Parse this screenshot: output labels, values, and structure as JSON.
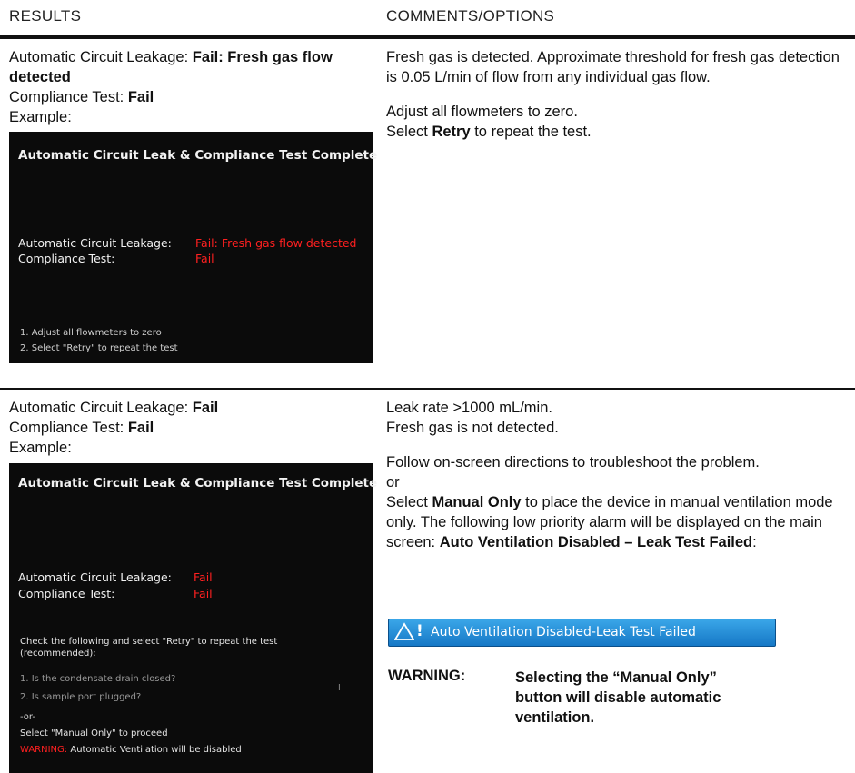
{
  "header": {
    "results": "RESULTS",
    "comments": "COMMENTS/OPTIONS"
  },
  "row1": {
    "left": {
      "leak_label": "Automatic Circuit Leakage: ",
      "leak_value": "Fail: Fresh gas flow detected",
      "comp_label": "Compliance Test: ",
      "comp_value": "Fail",
      "example": "Example:"
    },
    "screen": {
      "title": "Automatic Circuit Leak & Compliance Test Complete",
      "leak_label": "Automatic Circuit Leakage:",
      "leak_value": "Fail: Fresh gas flow detected",
      "comp_label": "Compliance Test:",
      "comp_value": "Fail",
      "step1": "1.   Adjust all flowmeters to zero",
      "step2": "2.   Select \"Retry\" to repeat the test"
    },
    "right": {
      "p1": "Fresh gas is detected. Approximate threshold for fresh gas detection is 0.05 L/min of flow from any individual gas flow.",
      "p2": "Adjust all flowmeters to zero.",
      "p3_pre": "Select ",
      "p3_bold": "Retry",
      "p3_post": " to repeat the test."
    }
  },
  "row2": {
    "left": {
      "leak_label": "Automatic Circuit Leakage: ",
      "leak_value": "Fail",
      "comp_label": "Compliance Test: ",
      "comp_value": "Fail",
      "example": "Example:"
    },
    "screen": {
      "title": "Automatic Circuit Leak & Compliance Test Complete",
      "leak_label": "Automatic Circuit Leakage:",
      "leak_value": "Fail",
      "comp_label": "Compliance Test:",
      "comp_value": "Fail",
      "check": "Check the following and select \"Retry\" to repeat the test (recommended):",
      "item1": "1.   Is the condensate drain closed?",
      "item2": "2.   Is sample port plugged?",
      "or": "-or-",
      "manual": "Select \"Manual Only\" to proceed",
      "warn_word": "WARNING:",
      "warn_text": " Automatic Ventilation will be disabled"
    },
    "right": {
      "p1": "Leak rate >1000 mL/min.",
      "p2": "Fresh gas is not detected.",
      "p3": "Follow on-screen directions to troubleshoot the problem.",
      "p4": "or",
      "p5_pre": "Select ",
      "p5_bold": "Manual Only",
      "p5_post": " to place the device in manual ventilation mode only. The following low priority alarm will be displayed on the main screen: ",
      "p5_bold2": "Auto Ventilation Disabled – Leak Test Failed",
      "p5_end": ":"
    },
    "alarm": {
      "excl": "!",
      "text": "Auto Ventilation Disabled-Leak Test Failed"
    },
    "warning": {
      "label": "WARNING:",
      "text": "Selecting the “Manual Only” button will disable automatic ventilation."
    },
    "cursor_glyph": "I"
  }
}
